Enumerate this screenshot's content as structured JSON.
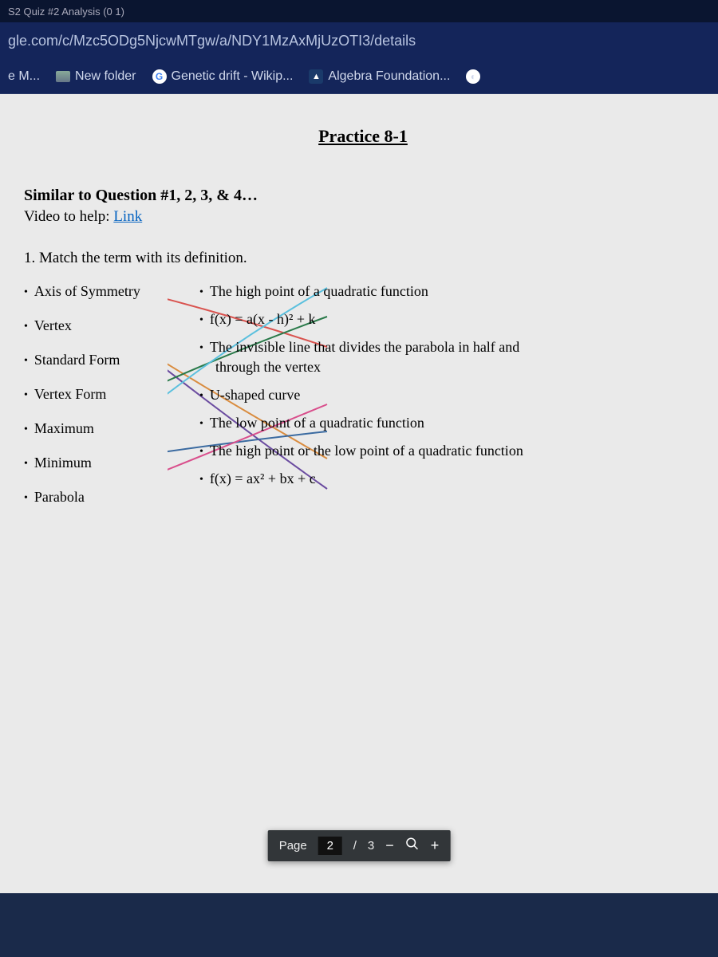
{
  "browser": {
    "tab_fragment": "S2 Quiz #2 Analysis (0 1)",
    "url": "gle.com/c/Mzc5ODg5NjcwMTgw/a/NDY1MzAxMjUzOTI3/details",
    "bookmarks": [
      {
        "label": "e M..."
      },
      {
        "label": "New folder"
      },
      {
        "label": "Genetic drift - Wikip..."
      },
      {
        "label": "Algebra Foundation..."
      }
    ]
  },
  "doc": {
    "title": "Practice 8-1",
    "similar": "Similar to Question #1, 2, 3, & 4…",
    "video_prefix": "Video to help: ",
    "video_link": "Link",
    "question": "1. Match the term with its definition.",
    "terms": [
      "Axis of Symmetry",
      "Vertex",
      "Standard Form",
      "Vertex Form",
      "Maximum",
      "Minimum",
      "Parabola"
    ],
    "defs": [
      "The high point of a quadratic function",
      "f(x) = a(x - h)² + k",
      "The invisible line that divides the parabola in half and",
      "through the vertex",
      "U-shaped curve",
      "The low point of a quadratic function",
      "The high point or the low point of a quadratic function",
      "f(x) = ax² + bx + c"
    ]
  },
  "pdf": {
    "page_label": "Page",
    "current_page": "2",
    "sep": "/",
    "total_pages": "3"
  }
}
